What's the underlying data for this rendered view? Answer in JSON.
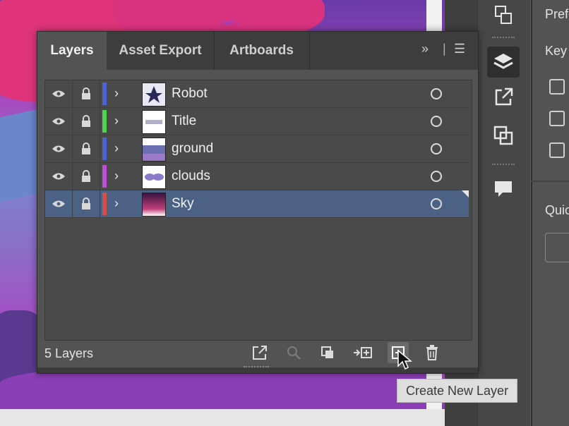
{
  "canvas": {
    "path_tag": "path"
  },
  "tabs": [
    {
      "label": "Layers"
    },
    {
      "label": "Asset Export"
    },
    {
      "label": "Artboards"
    }
  ],
  "tab_controls": {
    "expand_icon": "double-chevron-icon",
    "menu_icon": "hamburger-icon"
  },
  "layers": [
    {
      "name": "Robot",
      "color": "#4a63d6"
    },
    {
      "name": "Title",
      "color": "#4cd64a"
    },
    {
      "name": "ground",
      "color": "#4a63d6"
    },
    {
      "name": "clouds",
      "color": "#c04fd6"
    },
    {
      "name": "Sky",
      "color": "#d6504a",
      "selected": true
    }
  ],
  "footer": {
    "count_label": "5 Layers",
    "icons": [
      "export-icon",
      "search-icon",
      "clipping-mask-icon",
      "new-sublayer-icon",
      "new-layer-icon",
      "trash-icon"
    ]
  },
  "tooltip": "Create New Layer",
  "right_panel": {
    "labels": [
      "Pref",
      "Key",
      "Quic"
    ]
  },
  "dock": {
    "icons": [
      "arrange-icon",
      "layers-icon",
      "export-icon",
      "pathfinder-icon",
      "comment-icon"
    ]
  }
}
